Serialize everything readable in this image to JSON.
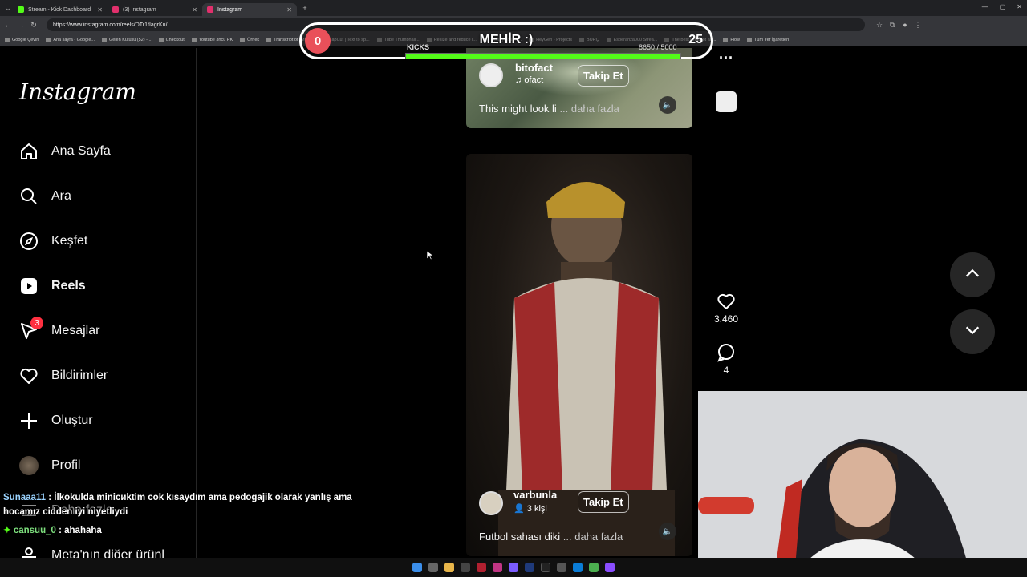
{
  "browser": {
    "tabs": [
      {
        "title": "Stream - Kick Dashboard",
        "active": false,
        "color": "#53fc18"
      },
      {
        "title": "(3) Instagram",
        "active": false,
        "color": "#e1306c"
      },
      {
        "title": "Instagram",
        "active": true,
        "color": "#e1306c"
      }
    ],
    "url": "https://www.instagram.com/reels/DTr1fIagrKu/",
    "bookmarks": [
      "Google Çeviri",
      "Ana sayfa - Google...",
      "Gelen Kutusu (52) -...",
      "Checkout",
      "Youtube 3ncü PK",
      "Örnek",
      "Transcript of \"Ml M...",
      "CapCut | Text to sp...",
      "Tube Thumbnail...",
      "Resize and reduce i...",
      "İspanyolca Or...",
      "HeyGen - Projects",
      "BURÇ",
      "Esperanza000 Strea...",
      "The best ChatBot an...",
      "Flow",
      "Tüm Yer İşaretleri"
    ]
  },
  "overlay": {
    "left_count": "0",
    "title": "MEHİR :)",
    "right_count": "25",
    "kicks_label": "KICKS",
    "kicks_value": "8650 / 5000",
    "kicks_progress": 1.0
  },
  "sidebar": {
    "logo": "Instagram",
    "items": [
      {
        "label": "Ana Sayfa",
        "icon": "home-icon"
      },
      {
        "label": "Ara",
        "icon": "search-icon"
      },
      {
        "label": "Keşfet",
        "icon": "compass-icon"
      },
      {
        "label": "Reels",
        "icon": "reels-icon",
        "active": true
      },
      {
        "label": "Mesajlar",
        "icon": "messenger-icon",
        "badge": "3"
      },
      {
        "label": "Bildirimler",
        "icon": "heart-icon"
      },
      {
        "label": "Oluştur",
        "icon": "plus-icon"
      },
      {
        "label": "Profil",
        "icon": "avatar"
      },
      {
        "label": "Daha fazla",
        "icon": "menu-icon"
      },
      {
        "label": "Meta'nın diğer ürünl",
        "icon": "meta-icon"
      }
    ]
  },
  "reel_top": {
    "username": "bitofact",
    "audio": "ofact",
    "follow_label": "Takip Et",
    "caption": "This might look li",
    "more_label": "... daha fazla"
  },
  "reel_main": {
    "username": "varbunla",
    "people": "3 kişi",
    "follow_label": "Takip Et",
    "caption": "Futbol sahası diki",
    "more_label": "... daha fazla"
  },
  "actions": {
    "likes": "3.460",
    "comments": "4"
  },
  "chat": [
    {
      "user": "Sunaaa11",
      "text": " : İlkokulda minicиktim cok kısaydım ama pedogajik olarak yanlış ama"
    },
    {
      "user": "",
      "text": "hocamız cidden iyi niyetliydi"
    },
    {
      "user": "cansuu_0",
      "text": " : ahahaha"
    }
  ]
}
